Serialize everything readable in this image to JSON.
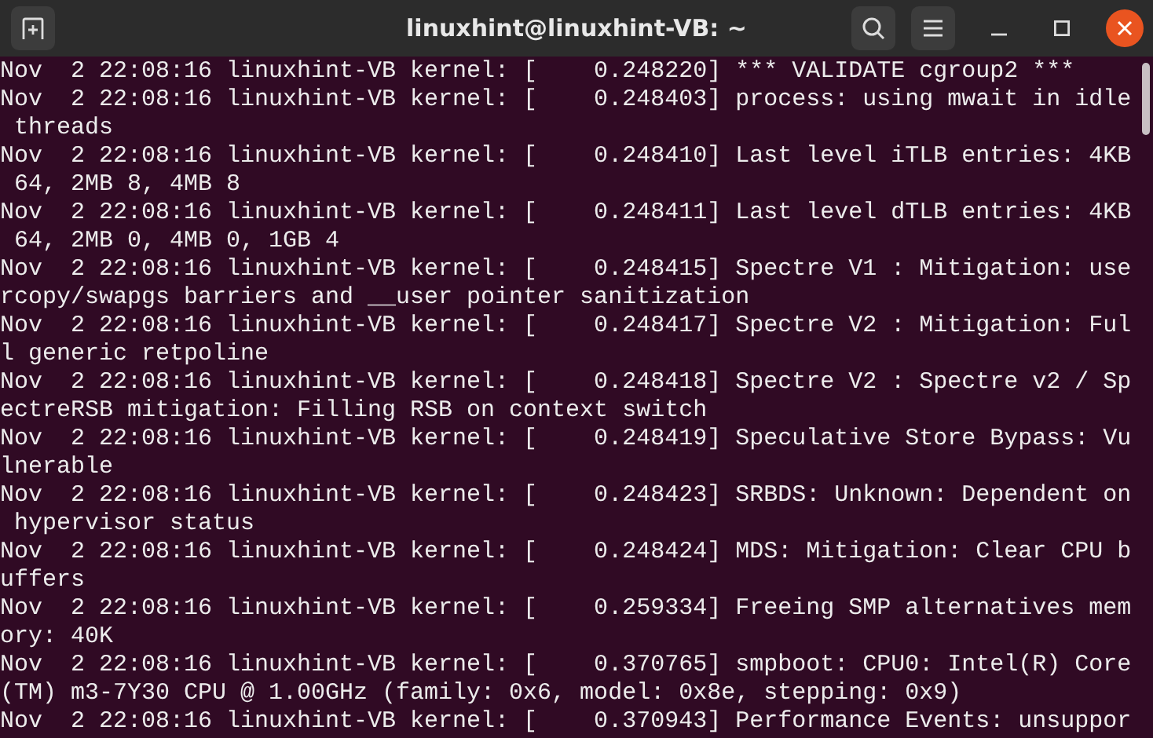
{
  "window": {
    "title": "linuxhint@linuxhint-VB: ~"
  },
  "terminal": {
    "lines": [
      "Nov  2 22:08:16 linuxhint-VB kernel: [    0.248220] *** VALIDATE cgroup2 ***",
      "Nov  2 22:08:16 linuxhint-VB kernel: [    0.248403] process: using mwait in idle",
      " threads",
      "Nov  2 22:08:16 linuxhint-VB kernel: [    0.248410] Last level iTLB entries: 4KB",
      " 64, 2MB 8, 4MB 8",
      "Nov  2 22:08:16 linuxhint-VB kernel: [    0.248411] Last level dTLB entries: 4KB",
      " 64, 2MB 0, 4MB 0, 1GB 4",
      "Nov  2 22:08:16 linuxhint-VB kernel: [    0.248415] Spectre V1 : Mitigation: use",
      "rcopy/swapgs barriers and __user pointer sanitization",
      "Nov  2 22:08:16 linuxhint-VB kernel: [    0.248417] Spectre V2 : Mitigation: Ful",
      "l generic retpoline",
      "Nov  2 22:08:16 linuxhint-VB kernel: [    0.248418] Spectre V2 : Spectre v2 / Sp",
      "ectreRSB mitigation: Filling RSB on context switch",
      "Nov  2 22:08:16 linuxhint-VB kernel: [    0.248419] Speculative Store Bypass: Vu",
      "lnerable",
      "Nov  2 22:08:16 linuxhint-VB kernel: [    0.248423] SRBDS: Unknown: Dependent on",
      " hypervisor status",
      "Nov  2 22:08:16 linuxhint-VB kernel: [    0.248424] MDS: Mitigation: Clear CPU b",
      "uffers",
      "Nov  2 22:08:16 linuxhint-VB kernel: [    0.259334] Freeing SMP alternatives mem",
      "ory: 40K",
      "Nov  2 22:08:16 linuxhint-VB kernel: [    0.370765] smpboot: CPU0: Intel(R) Core",
      "(TM) m3-7Y30 CPU @ 1.00GHz (family: 0x6, model: 0x8e, stepping: 0x9)",
      "Nov  2 22:08:16 linuxhint-VB kernel: [    0.370943] Performance Events: unsuppor"
    ]
  }
}
